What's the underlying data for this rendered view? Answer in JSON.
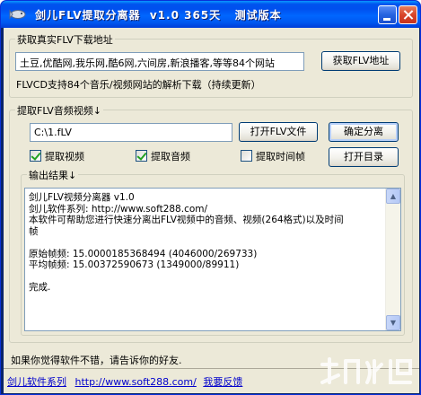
{
  "window": {
    "title": "剑儿FLV提取分离器  v1.0 365天   测试版本",
    "icon": "fish-app-icon",
    "controls": [
      "minimize-icon",
      "close-icon"
    ]
  },
  "url_group": {
    "label": "获取真实FLV下载地址",
    "url_value": "土豆,优酷网,我乐网,酷6网,六间房,新浪播客,等等84个网站",
    "get_button": "获取FLV地址",
    "support_text": "FLVCD支持84个音乐/视频网站的解析下载（持续更新）"
  },
  "extract_group": {
    "label": "提取FLV音频视频↓",
    "file_path": "C:\\1.fLV",
    "open_button": "打开FLV文件",
    "split_button": "确定分离",
    "chk_video": "提取视频",
    "chk_audio": "提取音频",
    "chk_timestamp": "提取时间帧",
    "open_dir_button": "打开目录"
  },
  "output_group": {
    "label": "输出结果↓",
    "lines": [
      "剑儿FLV视频分离器 v1.0",
      "剑儿软件系列: http://www.soft288.com/",
      "本软件可帮助您进行快速分离出FLV视频中的音频、视频(264格式)以及时间",
      "帧",
      "",
      "原始帧频: 15.0000185368494 (4046000/269733)",
      "平均帧频: 15.00372590673 (1349000/89911)",
      "",
      "完成."
    ]
  },
  "status": {
    "hint": "如果你觉得软件不错，请告诉你的好友.",
    "series_link": "剑儿软件系列",
    "url_link": "http://www.soft288.com/",
    "feedback_link": "我要反馈"
  },
  "colors": {
    "titlebar": "#0055ea",
    "face": "#ece9d8",
    "check_mark": "#21a121",
    "link": "#0000cc"
  }
}
